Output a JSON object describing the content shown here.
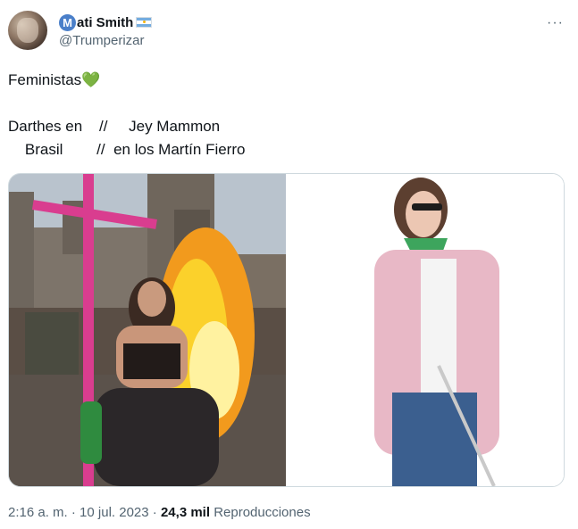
{
  "author": {
    "display_name": "ati Smith",
    "name_icon_letter": "M",
    "handle": "@Trumperizar",
    "flag": "argentina-flag-icon"
  },
  "menu": {
    "more_label": "···"
  },
  "tweet": {
    "line1": "Feministas",
    "line1_emoji": "💚",
    "line2": "Darthes en    //     Jey Mammon",
    "line3": "    Brasil        //  en los Martín Fierro"
  },
  "media": {
    "left_image": "protest-bonfire-photo",
    "right_image": "woman-with-green-scarf-photo"
  },
  "meta": {
    "time": "2:16 a. m.",
    "separator1": "·",
    "date": "10 jul. 2023",
    "separator2": "·",
    "views_count": "24,3 mil",
    "views_label": "Reproducciones"
  },
  "colors": {
    "text": "#0f1419",
    "secondary": "#536471",
    "border": "#cfd9de",
    "accent_blue": "#4a7fc9",
    "heart_green": "#3cb04a"
  }
}
